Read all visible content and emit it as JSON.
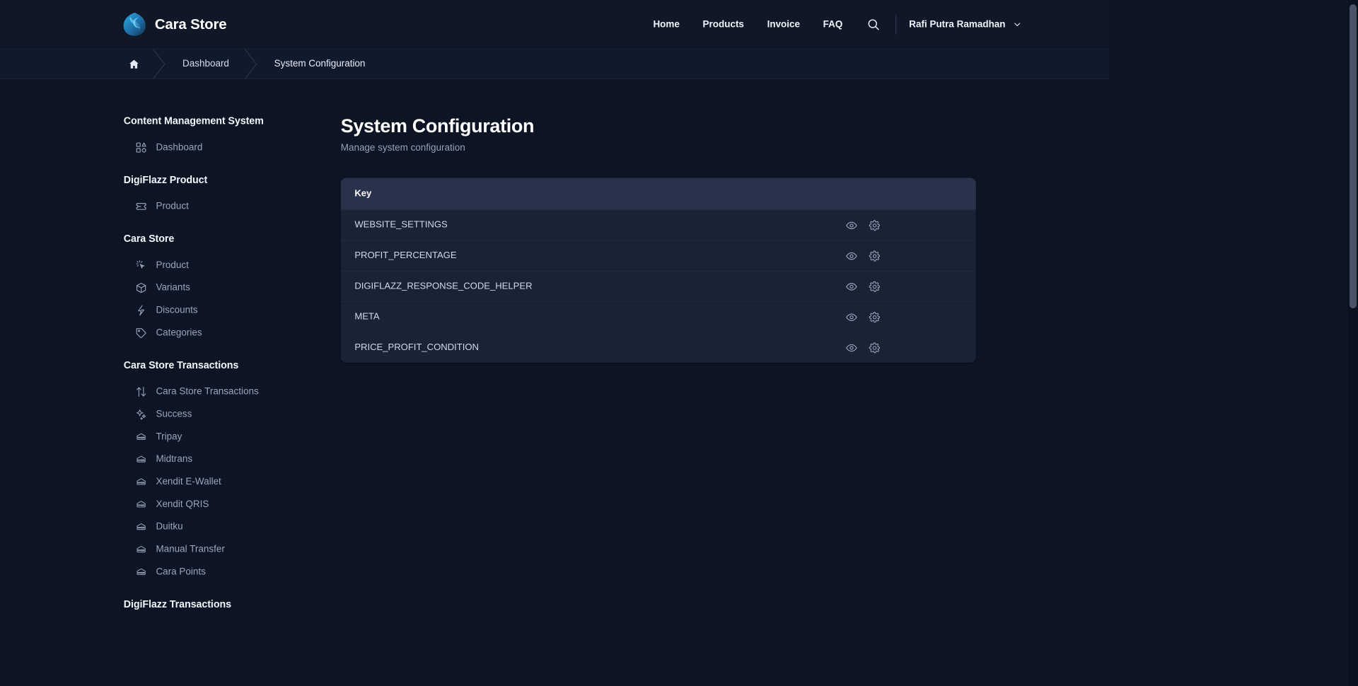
{
  "header": {
    "brand": {
      "name": "Cara Store",
      "logo_icon": "cara-leaf-logo-icon"
    },
    "nav": [
      {
        "label": "Home",
        "name": "nav-home"
      },
      {
        "label": "Products",
        "name": "nav-products"
      },
      {
        "label": "Invoice",
        "name": "nav-invoice"
      },
      {
        "label": "FAQ",
        "name": "nav-faq"
      }
    ],
    "search_icon": "search-icon",
    "user": {
      "name": "Rafi Putra Ramadhan",
      "chevron_icon": "chevron-down-icon"
    }
  },
  "breadcrumb": {
    "home_icon": "home-icon",
    "items": [
      {
        "label": "Dashboard"
      },
      {
        "label": "System Configuration"
      }
    ]
  },
  "sidebar": {
    "groups": [
      {
        "title": "Content Management System",
        "items": [
          {
            "label": "Dashboard",
            "icon": "layout-dashboard-icon"
          }
        ]
      },
      {
        "title": "DigiFlazz Product",
        "items": [
          {
            "label": "Product",
            "icon": "ticket-icon"
          }
        ]
      },
      {
        "title": "Cara Store",
        "items": [
          {
            "label": "Product",
            "icon": "cursor-click-icon"
          },
          {
            "label": "Variants",
            "icon": "box-3d-icon"
          },
          {
            "label": "Discounts",
            "icon": "zap-icon"
          },
          {
            "label": "Categories",
            "icon": "tag-icon"
          }
        ]
      },
      {
        "title": "Cara Store Transactions",
        "items": [
          {
            "label": "Cara Store Transactions",
            "icon": "arrows-up-down-icon"
          },
          {
            "label": "Success",
            "icon": "sparkles-icon"
          },
          {
            "label": "Tripay",
            "icon": "server-icon"
          },
          {
            "label": "Midtrans",
            "icon": "server-icon"
          },
          {
            "label": "Xendit E-Wallet",
            "icon": "server-icon"
          },
          {
            "label": "Xendit QRIS",
            "icon": "server-icon"
          },
          {
            "label": "Duitku",
            "icon": "server-icon"
          },
          {
            "label": "Manual Transfer",
            "icon": "server-icon"
          },
          {
            "label": "Cara Points",
            "icon": "server-icon"
          }
        ]
      },
      {
        "title": "DigiFlazz Transactions",
        "items": []
      }
    ]
  },
  "main": {
    "title": "System Configuration",
    "subtitle": "Manage system configuration",
    "table": {
      "columns": [
        "Key"
      ],
      "rows": [
        {
          "key": "WEBSITE_SETTINGS",
          "view_icon": "eye-icon",
          "settings_icon": "gear-icon"
        },
        {
          "key": "PROFIT_PERCENTAGE",
          "view_icon": "eye-icon",
          "settings_icon": "gear-icon"
        },
        {
          "key": "DIGIFLAZZ_RESPONSE_CODE_HELPER",
          "view_icon": "eye-icon",
          "settings_icon": "gear-icon"
        },
        {
          "key": "META",
          "view_icon": "eye-icon",
          "settings_icon": "gear-icon"
        },
        {
          "key": "PRICE_PROFIT_CONDITION",
          "view_icon": "eye-icon",
          "settings_icon": "gear-icon"
        }
      ]
    }
  },
  "colors": {
    "page_bg": "#0d1424",
    "header_bg": "#101828",
    "card_bg": "#1a2336",
    "table_head_bg": "#28324a",
    "accent": "#2b9fd8",
    "text_primary": "#ffffff",
    "text_muted": "#94a3b8"
  }
}
